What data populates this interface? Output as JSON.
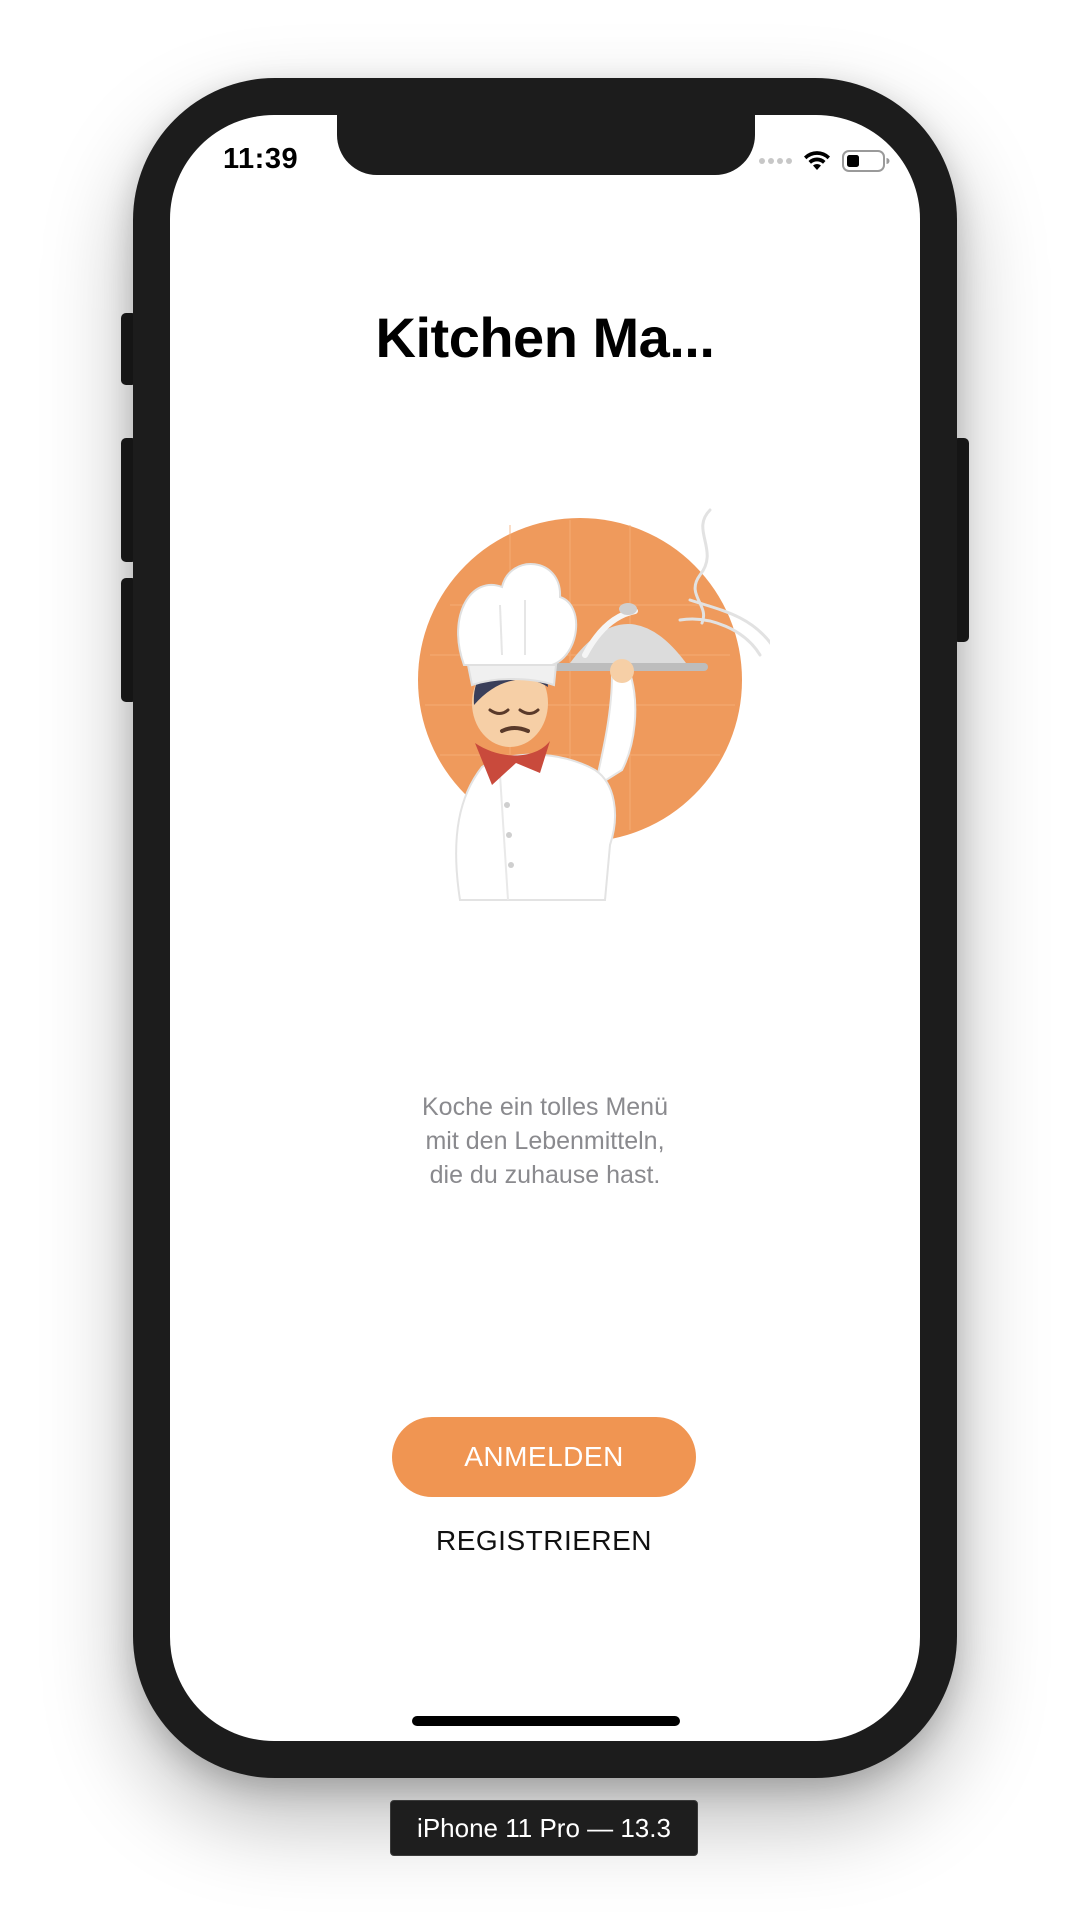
{
  "status_bar": {
    "time": "11:39",
    "icons": [
      "signal-dots-icon",
      "wifi-icon",
      "battery-icon"
    ]
  },
  "app": {
    "title": "Kitchen Ma...",
    "illustration": "chef-serving-cloche-illustration",
    "tagline": [
      "Koche ein tolles Menü",
      "mit den Lebenmitteln,",
      "die du zuhause hast."
    ],
    "login_label": "ANMELDEN",
    "register_label": "REGISTRIEREN"
  },
  "simulator": {
    "device_label": "iPhone 11 Pro — 13.3"
  },
  "colors": {
    "accent": "#f09552",
    "text_primary": "#000000",
    "text_secondary": "#8a8a8e",
    "device_frame": "#1c1c1c"
  }
}
